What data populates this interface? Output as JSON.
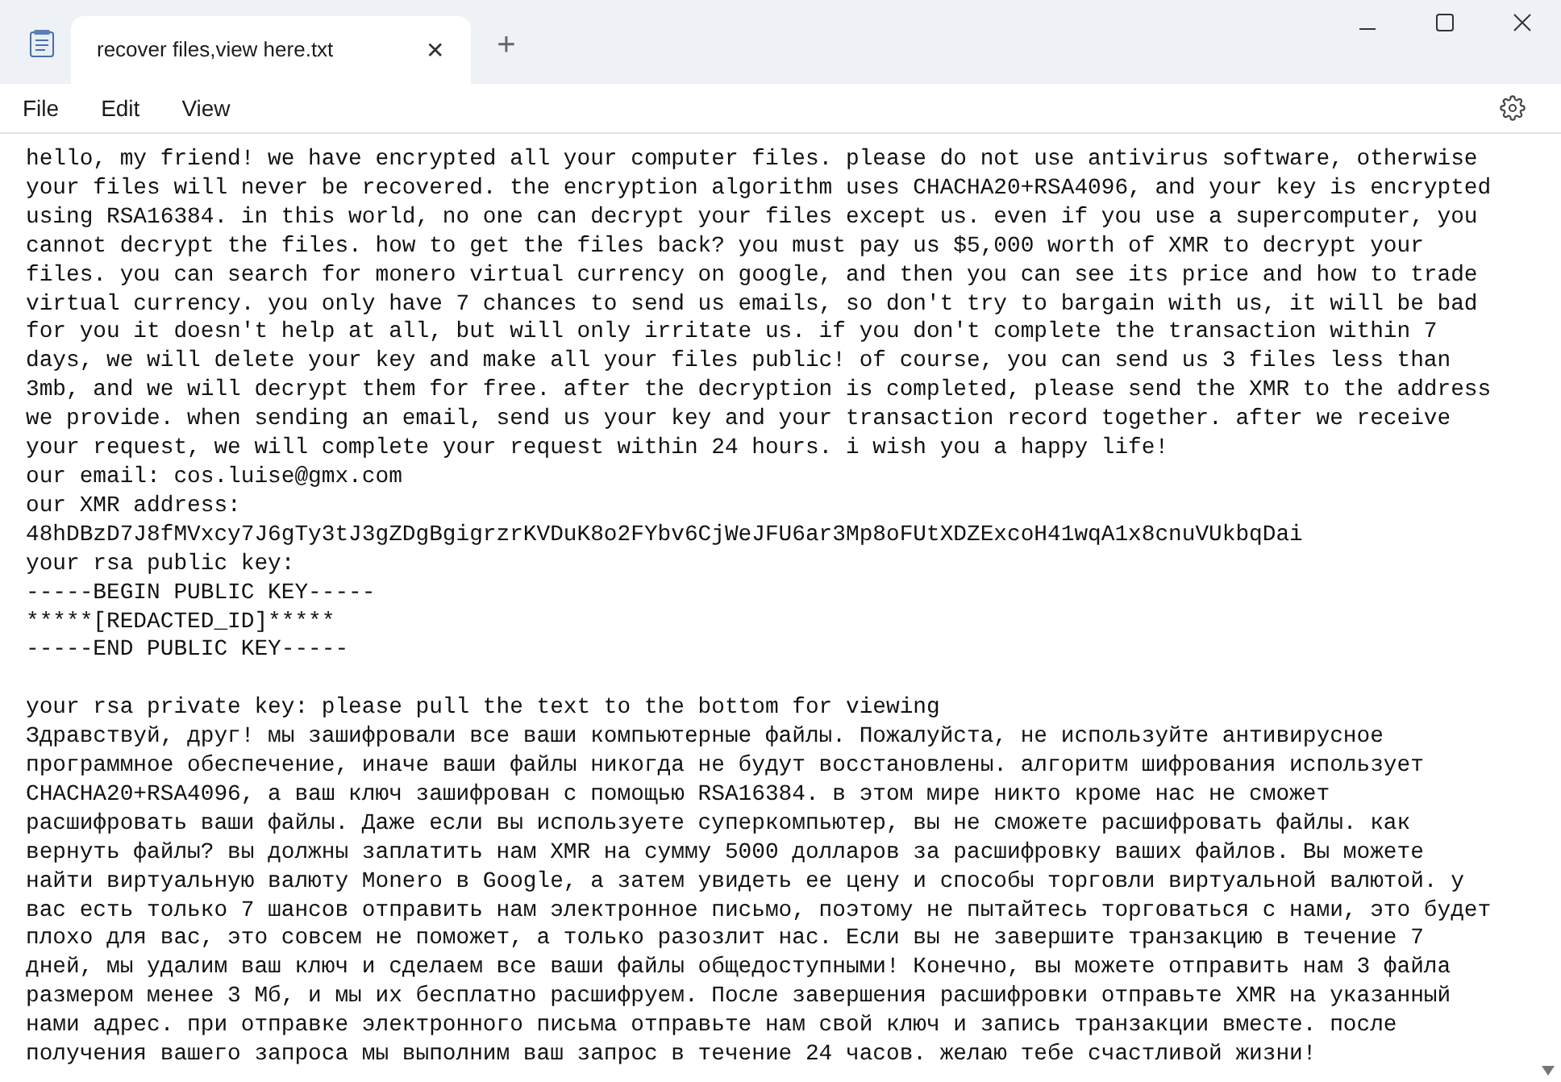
{
  "tab": {
    "title": "recover files,view here.txt",
    "close": "✕",
    "new_tab": "+"
  },
  "menu": [
    "File",
    "Edit",
    "View"
  ],
  "document": {
    "blocks": [
      {
        "lines": [
          "hello, my friend! we have encrypted all your computer files. please do not use antivirus software, otherwise",
          "your files will never be recovered. the encryption algorithm uses CHACHA20+RSA4096, and your key is encrypted",
          "using RSA16384. in this world, no one can decrypt your files except us. even if you use a supercomputer, you",
          "cannot decrypt the files. how to get the files back? you must pay us $5,000 worth of XMR to decrypt your",
          "files. you can search for monero virtual currency on google, and then you can see its price and how to trade",
          "virtual currency. you only have 7 chances to send us emails, so don't try to bargain with us, it will be bad",
          "for you it doesn't help at all, but will only irritate us. if you don't complete the transaction within 7",
          "days, we will delete your key and make all your files public! of course, you can send us 3 files less than",
          "3mb, and we will decrypt them for free. after the decryption is completed, please send the XMR to the address",
          "we provide. when sending an email, send us your key and your transaction record together. after we receive",
          "your request, we will complete your request within 24 hours. i wish you a happy life!",
          "our email: cos.luise@gmx.com",
          "our XMR address:",
          "48hDBzD7J8fMVxcy7J6gTy3tJ3gZDgBgigrzrKVDuK8o2FYbv6CjWeJFU6ar3Mp8oFUtXDZExcoH41wqA1x8cnuVUkbqDai",
          "your rsa public key:",
          "-----BEGIN PUBLIC KEY-----",
          "*****[REDACTED_ID]*****",
          "-----END PUBLIC KEY-----"
        ]
      },
      {
        "lines": [
          "your rsa private key: please pull the text to the bottom for viewing",
          "Здравствуй, друг! мы зашифровали все ваши компьютерные файлы. Пожалуйста, не используйте антивирусное",
          "программное обеспечение, иначе ваши файлы никогда не будут восстановлены. алгоритм шифрования использует",
          "CHACHA20+RSA4096, а ваш ключ зашифрован с помощью RSA16384. в этом мире никто кроме нас не сможет",
          "расшифровать ваши файлы. Даже если вы используете суперкомпьютер, вы не сможете расшифровать файлы. как",
          "вернуть файлы? вы должны заплатить нам XMR на сумму 5000 долларов за расшифровку ваших файлов. Вы можете",
          "найти виртуальную валюту Monero в Google, а затем увидеть ее цену и способы торговли виртуальной валютой. у",
          "вас есть только 7 шансов отправить нам электронное письмо, поэтому не пытайтесь торговаться с нами, это будет",
          "плохо для вас, это совсем не поможет, а только разозлит нас. Если вы не завершите транзакцию в течение 7",
          "дней, мы удалим ваш ключ и сделаем все ваши файлы общедоступными! Конечно, вы можете отправить нам 3 файла",
          "размером менее 3 Мб, и мы их бесплатно расшифруем. После завершения расшифровки отправьте XMR на указанный",
          "нами адрес. при отправке электронного письма отправьте нам свой ключ и запись транзакции вместе. после",
          "получения вашего запроса мы выполним ваш запрос в течение 24 часов. желаю тебе счастливой жизни!"
        ]
      }
    ]
  }
}
